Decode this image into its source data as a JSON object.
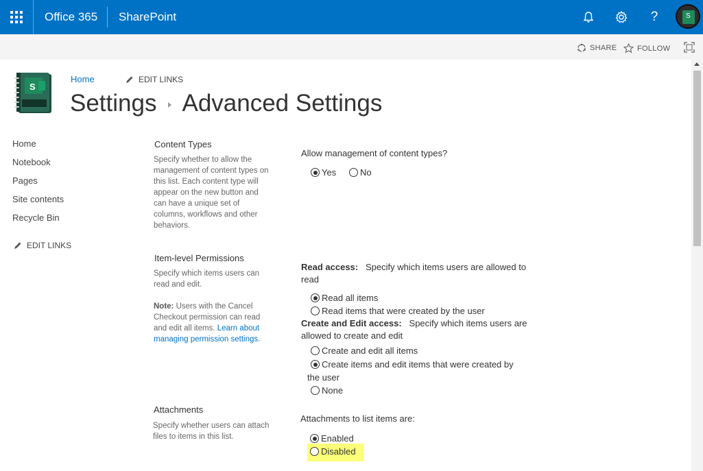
{
  "suite_bar": {
    "brand": "Office 365",
    "app": "SharePoint",
    "icons": [
      "app-launcher-icon",
      "bell-icon",
      "gear-icon",
      "help-icon",
      "avatar"
    ]
  },
  "command_bar": {
    "share": "SHARE",
    "follow": "FOLLOW"
  },
  "header": {
    "breadcrumb_home": "Home",
    "edit_links": "EDIT LINKS",
    "title_part1": "Settings",
    "title_part2": "Advanced Settings"
  },
  "left_nav": {
    "items": [
      "Home",
      "Notebook",
      "Pages",
      "Site contents",
      "Recycle Bin"
    ],
    "edit_links": "EDIT LINKS"
  },
  "sections": {
    "content_types": {
      "title": "Content Types",
      "description": "Specify whether to allow the management of content types on this list. Each content type will appear on the new button and can have a unique set of columns, workflows and other behaviors.",
      "question": "Allow management of content types?",
      "options": [
        {
          "label": "Yes",
          "checked": true
        },
        {
          "label": "No",
          "checked": false
        }
      ]
    },
    "item_permissions": {
      "title": "Item-level Permissions",
      "description": "Specify which items users can read and edit.",
      "note_label": "Note:",
      "note_text": "Users with the Cancel Checkout permission can read and edit all items.",
      "note_link": "Learn about managing permission settings.",
      "read_label": "Read access:",
      "read_desc": "Specify which items users are allowed to read",
      "read_options": [
        {
          "label": "Read all items",
          "checked": true
        },
        {
          "label": "Read items that were created by the user",
          "checked": false
        }
      ],
      "edit_label": "Create and Edit access:",
      "edit_desc": "Specify which items users are allowed to create and edit",
      "edit_options": [
        {
          "label": "Create and edit all items",
          "checked": false
        },
        {
          "label": "Create items and edit items that were created by",
          "label_wrap": "the user",
          "checked": true
        },
        {
          "label": "None",
          "checked": false
        }
      ]
    },
    "attachments": {
      "title": "Attachments",
      "description": "Specify whether users can attach files to items in this list.",
      "question": "Attachments to list items are:",
      "options": [
        {
          "label": "Enabled",
          "checked": true
        },
        {
          "label": "Disabled",
          "checked": false
        }
      ],
      "highlight_color": "#fcff78"
    }
  },
  "colors": {
    "suite_bar": "#0072c6",
    "link": "#0072c6"
  }
}
